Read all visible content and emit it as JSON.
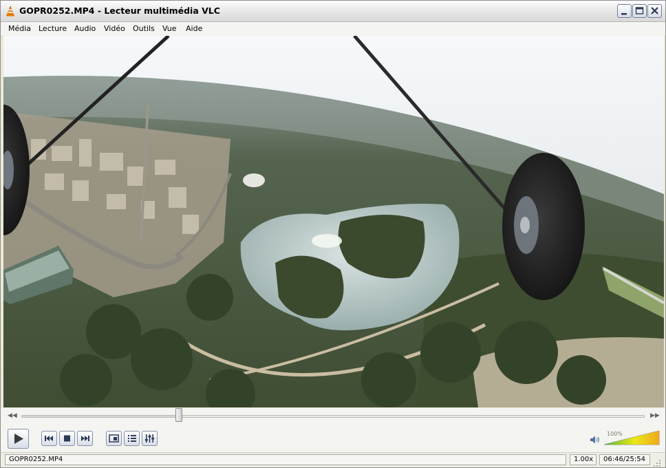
{
  "window": {
    "title": "GOPR0252.MP4 - Lecteur multimédia VLC"
  },
  "menu": {
    "items": [
      "Média",
      "Lecture",
      "Audio",
      "Vidéo",
      "Outils",
      "Vue",
      "Aide"
    ]
  },
  "playback": {
    "progress": 0.253
  },
  "volume": {
    "label": "100%",
    "level": 1.0
  },
  "status": {
    "filename": "GOPR0252.MP4",
    "speed": "1.00x",
    "time": "06:46/25:54"
  },
  "icons": {
    "app": "vlc-cone-icon",
    "play": "play-icon",
    "prev": "previous-icon",
    "stop": "stop-icon",
    "next": "next-icon",
    "fullscreen": "fullscreen-icon",
    "playlist": "playlist-icon",
    "equalizer": "extended-settings-icon",
    "volume": "speaker-icon"
  },
  "colors": {
    "accent_orange": "#f07d00",
    "button_border": "#8290a8"
  }
}
